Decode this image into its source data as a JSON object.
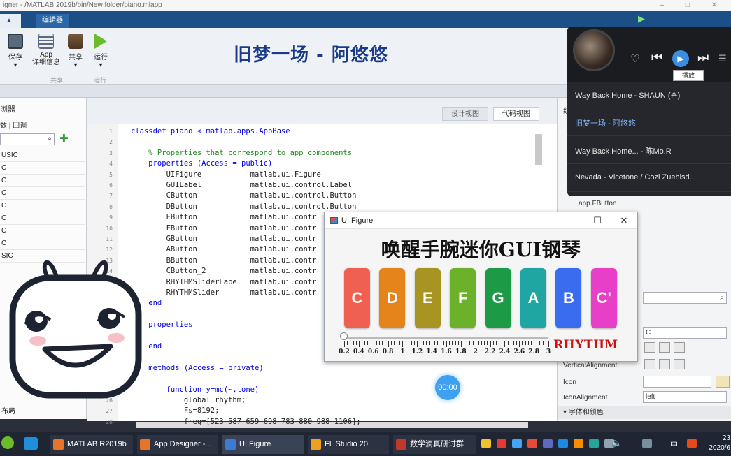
{
  "window": {
    "title": "igner - /MATLAB 2019b/bin/New folder/piano.mlapp"
  },
  "ribbon": {
    "tabs": [
      "编辑器"
    ],
    "buttons": [
      {
        "label": "保存",
        "icon": "save-icon"
      },
      {
        "label": "App\n详细信息",
        "icon": "app-details-icon"
      },
      {
        "label": "共享",
        "icon": "share-icon"
      },
      {
        "label": "运行",
        "icon": "run-icon"
      }
    ],
    "groups": [
      "共享",
      "运行"
    ]
  },
  "overlay_title": "旧梦一场 - 阿悠悠",
  "left_panel": {
    "header": "组件浏览器",
    "header_short": "浏器",
    "tabs": [
      "数",
      "回调"
    ],
    "items": [
      "USIC",
      "C",
      "C",
      "C",
      "C",
      "C",
      "C",
      "C",
      "SIC"
    ],
    "footer": "布局"
  },
  "editor": {
    "view_tabs": [
      "设计视图",
      "代码视图"
    ],
    "line_numbers": [
      "1",
      "2",
      "3",
      "4",
      "5",
      "6",
      "7",
      "8",
      "9",
      "10",
      "11",
      "12",
      "13",
      "14",
      "15",
      "16",
      "",
      "",
      "",
      "",
      "",
      "",
      "",
      "",
      "",
      "26",
      "27",
      "28"
    ],
    "lines": [
      {
        "t": "classdef piano < matlab.apps.AppBase",
        "c": "kw"
      },
      {
        "t": "",
        "c": ""
      },
      {
        "t": "    % Properties that correspond to app components",
        "c": "cm"
      },
      {
        "t": "    properties (Access = public)",
        "c": "kw"
      },
      {
        "t": "        UIFigure           matlab.ui.Figure",
        "c": ""
      },
      {
        "t": "        GUILabel           matlab.ui.control.Label",
        "c": ""
      },
      {
        "t": "        CButton            matlab.ui.control.Button",
        "c": ""
      },
      {
        "t": "        DButton            matlab.ui.control.Button",
        "c": ""
      },
      {
        "t": "        EButton            matlab.ui.contr",
        "c": ""
      },
      {
        "t": "        FButton            matlab.ui.contr",
        "c": ""
      },
      {
        "t": "        GButton            matlab.ui.contr",
        "c": ""
      },
      {
        "t": "        AButton            matlab.ui.contr",
        "c": ""
      },
      {
        "t": "        BButton            matlab.ui.contr",
        "c": ""
      },
      {
        "t": "        CButton_2          matlab.ui.contr",
        "c": ""
      },
      {
        "t": "        RHYTHMSliderLabel  matlab.ui.contr",
        "c": ""
      },
      {
        "t": "        RHYTHMSlider       matlab.ui.contr",
        "c": ""
      },
      {
        "t": "    end",
        "c": "kw"
      },
      {
        "t": "",
        "c": ""
      },
      {
        "t": "    properties",
        "c": "kw"
      },
      {
        "t": "",
        "c": ""
      },
      {
        "t": "    end",
        "c": "kw"
      },
      {
        "t": "",
        "c": ""
      },
      {
        "t": "    methods (Access = private)",
        "c": "kw"
      },
      {
        "t": "",
        "c": ""
      },
      {
        "t": "        function y=mc(~,tone)",
        "c": "kw"
      },
      {
        "t": "            global rhythm;",
        "c": ""
      },
      {
        "t": "            Fs=8192;",
        "c": ""
      },
      {
        "t": "            freq=[523 587 659 698 783 880 988 1106];",
        "c": ""
      }
    ]
  },
  "right_panel": {
    "header": "组",
    "component_ref": "app.FButton",
    "text_value": "C",
    "vertical_alignment_label": "VerticalAlignment",
    "icon_label": "Icon",
    "icon_alignment_label": "IconAlignment",
    "icon_alignment_value": "left",
    "section": "字体和颜色"
  },
  "player": {
    "tooltip": "播放",
    "playlist": [
      "Way Back Home - SHAUN (숀)",
      "旧梦一场 - 阿悠悠",
      "Way Back Home... - 陈Mo.R",
      "Nevada - Vicetone / Cozi Zuehlsd..."
    ],
    "active_index": 1
  },
  "ui_figure": {
    "title": "UI Figure",
    "heading": "唤醒手腕迷你GUI钢琴",
    "keys": [
      {
        "label": "C",
        "color": "#f06050"
      },
      {
        "label": "D",
        "color": "#e6841c"
      },
      {
        "label": "E",
        "color": "#a89422"
      },
      {
        "label": "F",
        "color": "#6cb12a"
      },
      {
        "label": "G",
        "color": "#1d9a45"
      },
      {
        "label": "A",
        "color": "#1fa6a2"
      },
      {
        "label": "B",
        "color": "#3a6cf0"
      },
      {
        "label": "C'",
        "color": "#e83fc8"
      }
    ],
    "slider": {
      "label": "RHYTHM",
      "value": 0.2,
      "min": 0.2,
      "max": 3,
      "ticks": [
        "0.2",
        "0.4",
        "0.6",
        "0.8",
        "1",
        "1.2",
        "1.4",
        "1.6",
        "1.8",
        "2",
        "2.2",
        "2.4",
        "2.6",
        "2.8",
        "3"
      ]
    }
  },
  "timer": "00:00",
  "taskbar": {
    "items": [
      {
        "label": "MATLAB R2019b",
        "color": "#e8742a"
      },
      {
        "label": "App Designer -...",
        "color": "#e8742a"
      },
      {
        "label": "UI Figure",
        "color": "#3a7bd5"
      },
      {
        "label": "FL Studio 20",
        "color": "#f0a020"
      },
      {
        "label": "数学滴真研讨群",
        "color": "#c0392b"
      }
    ],
    "ime": "中",
    "clock": [
      "23",
      "2020/6"
    ]
  }
}
